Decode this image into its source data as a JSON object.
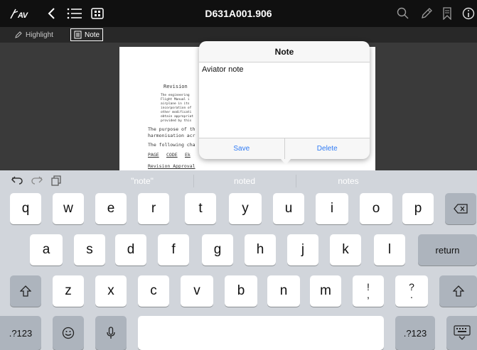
{
  "topbar": {
    "logo": "AV",
    "doc_title": "D631A001.906",
    "icons": [
      "aviator-logo-icon",
      "back-icon",
      "list-icon",
      "thumbnail-grid-icon",
      "search-icon",
      "pencil-icon",
      "bookmark-icon",
      "info-icon"
    ]
  },
  "toolbar2": {
    "highlight_label": "Highlight",
    "note_label": "Note"
  },
  "document": {
    "heading": "Revision",
    "para1": [
      "The engineering",
      "Flight Manual i",
      "airplane in its",
      "incorporation of",
      "other modificati",
      "obtain appropriat",
      "provided by this"
    ],
    "para2": [
      "The purpose of th",
      "harmonisation acr"
    ],
    "para3": "The following cha",
    "table_header": [
      "PAGE",
      "CODE",
      "Ek"
    ],
    "approval": "Revision Approval"
  },
  "note_popover": {
    "title": "Note",
    "text": "Aviator note",
    "save_label": "Save",
    "delete_label": "Delete"
  },
  "keyboard": {
    "undo_icons": [
      "undo-icon",
      "redo-icon",
      "paste-icon"
    ],
    "suggestions": [
      "\"note\"",
      "noted",
      "notes"
    ],
    "row1": [
      "q",
      "w",
      "e",
      "r",
      "t",
      "y",
      "u",
      "i",
      "o",
      "p"
    ],
    "row2": [
      "a",
      "s",
      "d",
      "f",
      "g",
      "h",
      "j",
      "k",
      "l"
    ],
    "row3": [
      "z",
      "x",
      "c",
      "v",
      "b",
      "n",
      "m"
    ],
    "punct1": [
      "!",
      ","
    ],
    "punct2": [
      "?",
      "."
    ],
    "return_label": "return",
    "numbers_label": ".?123"
  },
  "colors": {
    "accent": "#2f7bf5",
    "topbar_bg": "#101010",
    "toolbar_bg": "#282828",
    "doc_bg": "#3a3a3a",
    "keyboard_bg": "#d1d5db"
  }
}
